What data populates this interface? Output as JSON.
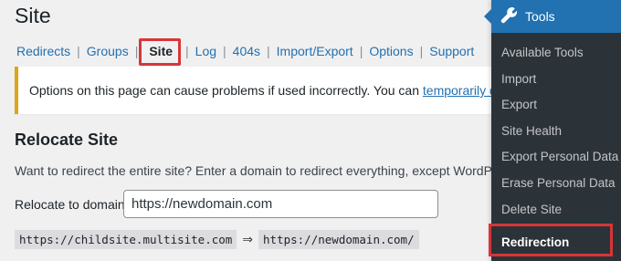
{
  "page": {
    "title": "Site"
  },
  "subnav": {
    "items": [
      "Redirects",
      "Groups",
      "Site",
      "Log",
      "404s",
      "Import/Export",
      "Options",
      "Support"
    ],
    "current": "Site"
  },
  "notice": {
    "text": "Options on this page can cause problems if used incorrectly. You can ",
    "link": "temporarily disable th"
  },
  "relocate": {
    "heading": "Relocate Site",
    "description": "Want to redirect the entire site? Enter a domain to redirect everything, except WordPress logi",
    "label": "Relocate to domain:",
    "value": "https://newdomain.com",
    "from": "https://childsite.multisite.com",
    "arrow": "⇒",
    "to": "https://newdomain.com/"
  },
  "admin_menu": {
    "title": "Tools",
    "icon": "wrench-icon",
    "items": [
      "Available Tools",
      "Import",
      "Export",
      "Site Health",
      "Export Personal Data",
      "Erase Personal Data",
      "Delete Site",
      "Redirection"
    ],
    "current": "Redirection"
  },
  "colors": {
    "accent": "#2271b1",
    "highlight": "#d63638",
    "notice_border": "#dba617",
    "menu_bg": "#2c3338"
  }
}
